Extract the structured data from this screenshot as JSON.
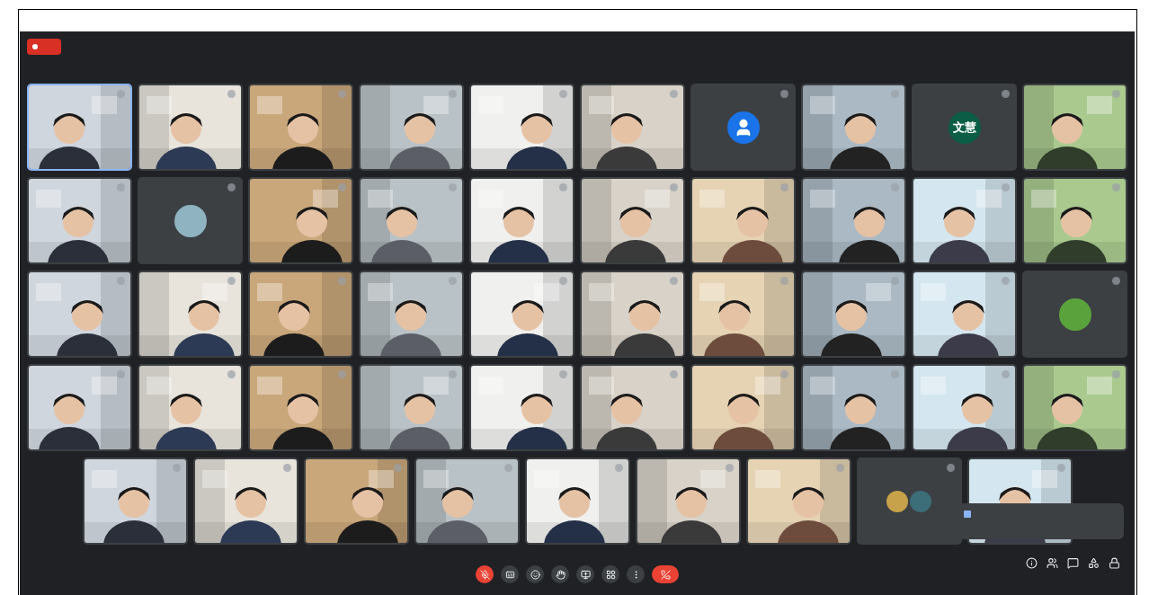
{
  "recording": {
    "active": true
  },
  "rows": [
    [
      {
        "kind": "video",
        "speaking": true
      },
      {
        "kind": "video",
        "speaking": false
      },
      {
        "kind": "video",
        "speaking": false
      },
      {
        "kind": "video",
        "speaking": false
      },
      {
        "kind": "video",
        "speaking": false
      },
      {
        "kind": "video",
        "speaking": false
      },
      {
        "kind": "avatar-person",
        "speaking": false,
        "color": "#1a73e8"
      },
      {
        "kind": "video",
        "speaking": false
      },
      {
        "kind": "avatar",
        "speaking": false,
        "color": "#0b5e45",
        "initials": "文慧"
      },
      {
        "kind": "video",
        "speaking": false
      }
    ],
    [
      {
        "kind": "video",
        "speaking": false
      },
      {
        "kind": "avatar",
        "speaking": false,
        "color": "#8fb3c0"
      },
      {
        "kind": "video",
        "speaking": false
      },
      {
        "kind": "video",
        "speaking": false
      },
      {
        "kind": "video",
        "speaking": false
      },
      {
        "kind": "video",
        "speaking": false
      },
      {
        "kind": "video",
        "speaking": false
      },
      {
        "kind": "video",
        "speaking": false
      },
      {
        "kind": "video",
        "speaking": false
      },
      {
        "kind": "video",
        "speaking": false
      }
    ],
    [
      {
        "kind": "video",
        "speaking": false
      },
      {
        "kind": "video",
        "speaking": false
      },
      {
        "kind": "video",
        "speaking": false
      },
      {
        "kind": "video",
        "speaking": false
      },
      {
        "kind": "video",
        "speaking": false
      },
      {
        "kind": "video",
        "speaking": false
      },
      {
        "kind": "video",
        "speaking": false
      },
      {
        "kind": "video",
        "speaking": false
      },
      {
        "kind": "video",
        "speaking": false
      },
      {
        "kind": "avatar",
        "speaking": false,
        "color": "#5aa33c"
      }
    ],
    [
      {
        "kind": "video",
        "speaking": false
      },
      {
        "kind": "video",
        "speaking": false
      },
      {
        "kind": "video",
        "speaking": false
      },
      {
        "kind": "video",
        "speaking": false
      },
      {
        "kind": "video",
        "speaking": false
      },
      {
        "kind": "video",
        "speaking": false
      },
      {
        "kind": "video",
        "speaking": false
      },
      {
        "kind": "video",
        "speaking": false
      },
      {
        "kind": "video",
        "speaking": false
      },
      {
        "kind": "video",
        "speaking": false
      }
    ],
    [
      {
        "kind": "video",
        "speaking": false
      },
      {
        "kind": "video",
        "speaking": false
      },
      {
        "kind": "video",
        "speaking": false
      },
      {
        "kind": "video",
        "speaking": false
      },
      {
        "kind": "video",
        "speaking": false
      },
      {
        "kind": "video",
        "speaking": false
      },
      {
        "kind": "video",
        "speaking": false
      },
      {
        "kind": "avatar-pair",
        "speaking": false,
        "color": "#3c6e7a"
      },
      {
        "kind": "video",
        "speaking": false
      }
    ]
  ],
  "controls": [
    {
      "kind": "mic",
      "muted": true
    },
    {
      "kind": "captions",
      "muted": false
    },
    {
      "kind": "emoji",
      "muted": false
    },
    {
      "kind": "hand",
      "muted": false
    },
    {
      "kind": "present",
      "muted": false
    },
    {
      "kind": "layout",
      "muted": false
    },
    {
      "kind": "more",
      "muted": false
    },
    {
      "kind": "hangup"
    }
  ],
  "side_controls": [
    {
      "kind": "info"
    },
    {
      "kind": "people"
    },
    {
      "kind": "chat"
    },
    {
      "kind": "activities"
    },
    {
      "kind": "lock"
    }
  ]
}
